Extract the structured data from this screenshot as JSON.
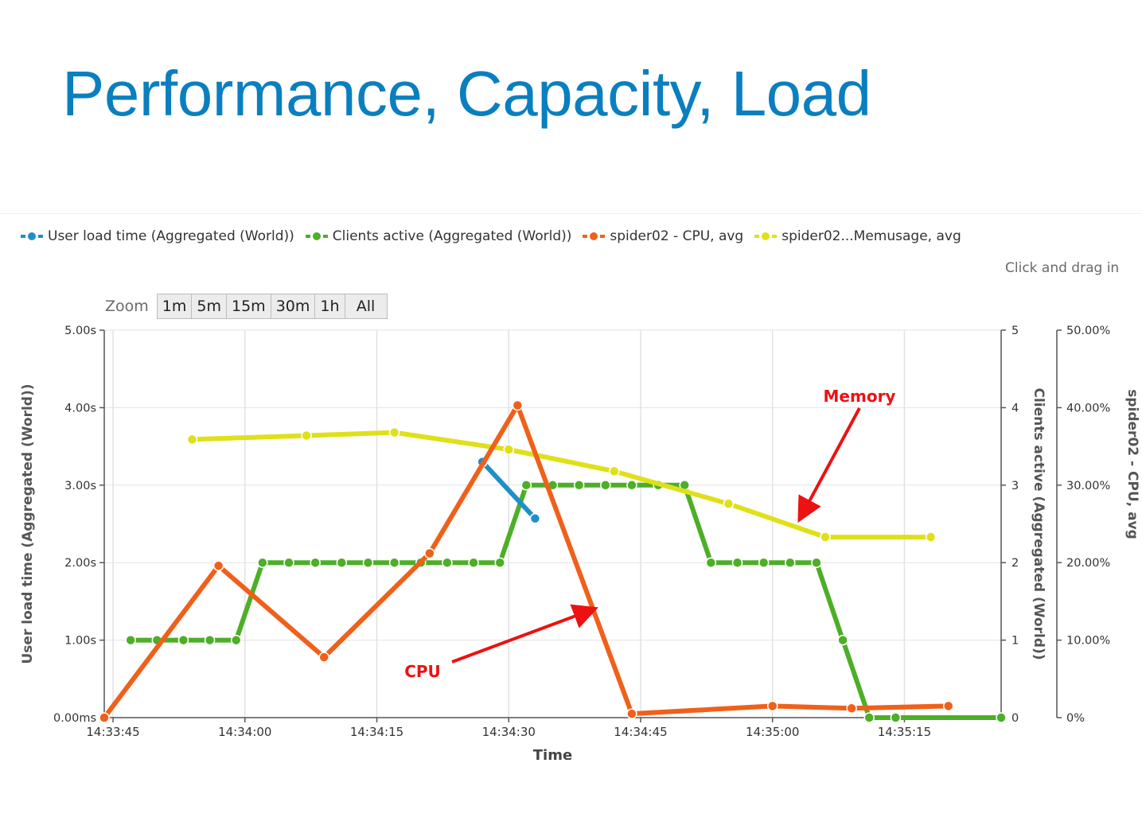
{
  "slide": {
    "title": "Performance, Capacity, Load"
  },
  "colors": {
    "title": "#0a7fc0",
    "user_load": "#1f8fc9",
    "clients": "#4caf27",
    "cpu": "#f0601a",
    "memory": "#dfe01a",
    "annotation": "#ee1111"
  },
  "legend": [
    {
      "label": "User load time (Aggregated (World))",
      "color": "#1f8fc9"
    },
    {
      "label": "Clients active (Aggregated (World))",
      "color": "#4caf27"
    },
    {
      "label": "spider02 - CPU, avg",
      "color": "#f0601a"
    },
    {
      "label": "spider02...Memusage, avg",
      "color": "#dfe01a"
    }
  ],
  "hint": "Click and drag in",
  "zoom": {
    "label": "Zoom",
    "buttons": [
      "1m",
      "5m",
      "15m",
      "30m",
      "1h",
      "All"
    ]
  },
  "chart_data": {
    "type": "line",
    "xlabel": "Time",
    "x_range": [
      "14:33:44",
      "14:35:26"
    ],
    "x_ticks": [
      "14:33:45",
      "14:34:00",
      "14:34:15",
      "14:34:30",
      "14:34:45",
      "14:35:00",
      "14:35:15"
    ],
    "axes": {
      "left": {
        "label": "User load time (Aggregated (World))",
        "range": [
          0,
          5
        ],
        "tick_values": [
          0,
          1,
          2,
          3,
          4,
          5
        ],
        "ticks": [
          "0.00ms",
          "1.00s",
          "2.00s",
          "3.00s",
          "4.00s",
          "5.00s"
        ]
      },
      "right1": {
        "label": "Clients active (Aggregated (World))",
        "range": [
          0,
          5
        ],
        "tick_values": [
          0,
          1,
          2,
          3,
          4,
          5
        ],
        "ticks": [
          "0",
          "1",
          "2",
          "3",
          "4",
          "5"
        ]
      },
      "right2": {
        "label": "spider02 - CPU, avg",
        "range": [
          0,
          50
        ],
        "tick_values": [
          0,
          10,
          20,
          30,
          40,
          50
        ],
        "ticks": [
          "0%",
          "10.00%",
          "20.00%",
          "30.00%",
          "40.00%",
          "50.00%"
        ]
      }
    },
    "grid": true,
    "legend_position": "top",
    "series": [
      {
        "name": "User load time (Aggregated (World))",
        "axis": "left",
        "color": "#1f8fc9",
        "dash": false,
        "points": [
          [
            "14:34:27",
            3.3
          ],
          [
            "14:34:33",
            2.57
          ]
        ]
      },
      {
        "name": "Clients active (Aggregated (World))",
        "axis": "right1",
        "color": "#4caf27",
        "dash": true,
        "points": [
          [
            "14:33:47",
            1
          ],
          [
            "14:33:50",
            1
          ],
          [
            "14:33:53",
            1
          ],
          [
            "14:33:56",
            1
          ],
          [
            "14:33:59",
            1
          ],
          [
            "14:34:02",
            2
          ],
          [
            "14:34:05",
            2
          ],
          [
            "14:34:08",
            2
          ],
          [
            "14:34:11",
            2
          ],
          [
            "14:34:14",
            2
          ],
          [
            "14:34:17",
            2
          ],
          [
            "14:34:20",
            2
          ],
          [
            "14:34:23",
            2
          ],
          [
            "14:34:26",
            2
          ],
          [
            "14:34:29",
            2
          ],
          [
            "14:34:32",
            3
          ],
          [
            "14:34:35",
            3
          ],
          [
            "14:34:38",
            3
          ],
          [
            "14:34:41",
            3
          ],
          [
            "14:34:44",
            3
          ],
          [
            "14:34:47",
            3
          ],
          [
            "14:34:50",
            3
          ],
          [
            "14:34:53",
            2
          ],
          [
            "14:34:56",
            2
          ],
          [
            "14:34:59",
            2
          ],
          [
            "14:35:02",
            2
          ],
          [
            "14:35:05",
            2
          ],
          [
            "14:35:08",
            1
          ],
          [
            "14:35:11",
            0
          ],
          [
            "14:35:14",
            0
          ],
          [
            "14:35:26",
            0
          ]
        ]
      },
      {
        "name": "spider02 - CPU, avg",
        "axis": "right2",
        "color": "#f0601a",
        "dash": false,
        "points": [
          [
            "14:33:44",
            0
          ],
          [
            "14:33:57",
            19.6
          ],
          [
            "14:34:09",
            7.8
          ],
          [
            "14:34:21",
            21.2
          ],
          [
            "14:34:31",
            40.3
          ],
          [
            "14:34:44",
            0.5
          ],
          [
            "14:35:00",
            1.5
          ],
          [
            "14:35:09",
            1.2
          ],
          [
            "14:35:20",
            1.5
          ]
        ]
      },
      {
        "name": "spider02...Memusage, avg",
        "axis": "right2",
        "color": "#dfe01a",
        "dash": false,
        "points": [
          [
            "14:33:54",
            35.9
          ],
          [
            "14:34:07",
            36.4
          ],
          [
            "14:34:17",
            36.8
          ],
          [
            "14:34:30",
            34.6
          ],
          [
            "14:34:42",
            31.8
          ],
          [
            "14:34:55",
            27.6
          ],
          [
            "14:35:06",
            23.3
          ],
          [
            "14:35:18",
            23.3
          ]
        ]
      }
    ],
    "annotations": [
      {
        "text": "Memory",
        "target_series": "spider02...Memusage, avg",
        "color": "#ee1111"
      },
      {
        "text": "CPU",
        "target_series": "spider02 - CPU, avg",
        "color": "#ee1111"
      }
    ]
  }
}
